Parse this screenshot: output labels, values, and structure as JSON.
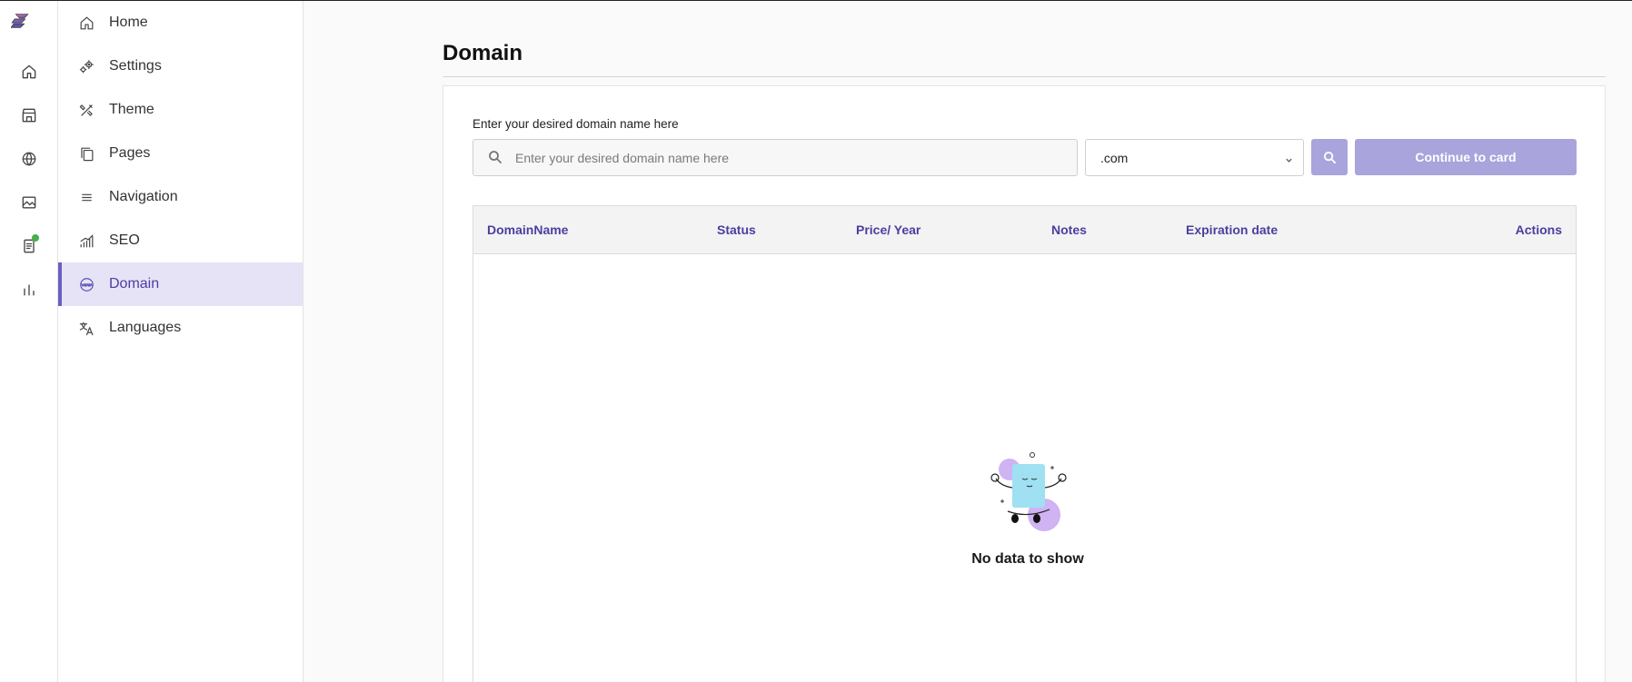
{
  "menu": {
    "items": [
      {
        "label": "Home",
        "icon": "home-icon"
      },
      {
        "label": "Settings",
        "icon": "gears-icon"
      },
      {
        "label": "Theme",
        "icon": "design-tools-icon"
      },
      {
        "label": "Pages",
        "icon": "pages-icon"
      },
      {
        "label": "Navigation",
        "icon": "hamburger-menu-icon"
      },
      {
        "label": "SEO",
        "icon": "seo-graph-icon"
      },
      {
        "label": "Domain",
        "icon": "www-globe-icon",
        "active": true
      },
      {
        "label": "Languages",
        "icon": "translate-icon"
      }
    ]
  },
  "rail": {
    "icons": [
      "logo",
      "home-icon",
      "store-icon",
      "globe-icon",
      "gallery-icon",
      "orders-icon",
      "analytics-icon"
    ],
    "status_dot_color": "#46b04a"
  },
  "page": {
    "title": "Domain"
  },
  "search": {
    "label": "Enter your desired domain name here",
    "placeholder": "Enter your desired domain name here",
    "value": "",
    "tld_selected": ".com",
    "continue_label": "Continue to card"
  },
  "table": {
    "columns": [
      "DomainName",
      "Status",
      "Price/ Year",
      "Notes",
      "Expiration date",
      "Actions"
    ],
    "rows": [],
    "empty_text": "No data to show"
  },
  "colors": {
    "accent": "#6b5fc1",
    "accent_light": "#e6e3f7",
    "button_disabled": "#a9a4db",
    "header_text": "#4a3f9f"
  }
}
